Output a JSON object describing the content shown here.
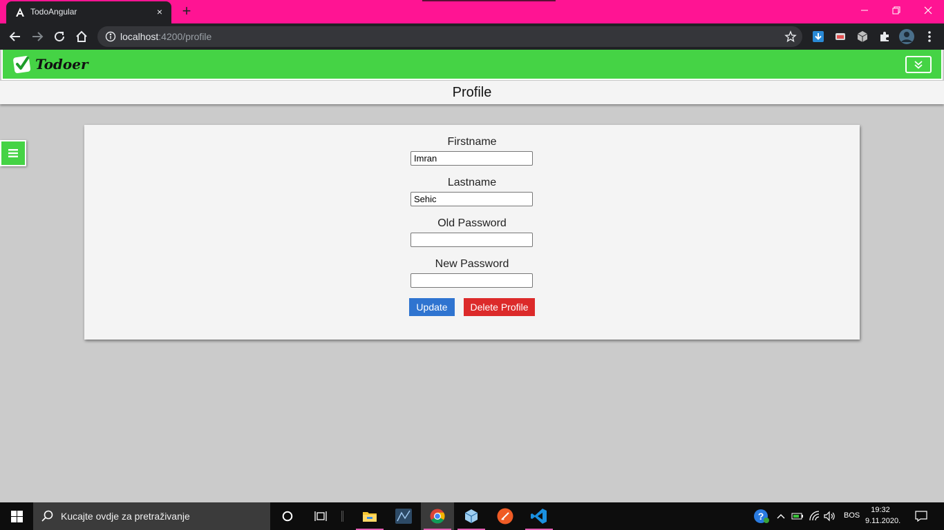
{
  "browser": {
    "tab_title": "TodoAngular",
    "url_host": "localhost",
    "url_path": ":4200/profile",
    "new_tab_symbol": "+",
    "close_symbol": "×",
    "colors": {
      "titlebar": "#ff1493",
      "toolbar": "#202124"
    }
  },
  "app": {
    "brand": "Todoer",
    "page_title": "Profile",
    "colors": {
      "navbar": "#45d345",
      "update": "#2f74d0",
      "delete": "#dc2a2a"
    }
  },
  "form": {
    "firstname": {
      "label": "Firstname",
      "value": "Imran"
    },
    "lastname": {
      "label": "Lastname",
      "value": "Sehic"
    },
    "old_password": {
      "label": "Old Password",
      "value": ""
    },
    "new_password": {
      "label": "New Password",
      "value": ""
    },
    "update_label": "Update",
    "delete_label": "Delete Profile"
  },
  "taskbar": {
    "search_placeholder": "Kucajte ovdje za pretraživanje",
    "language": "BOS",
    "time": "19:32",
    "date": "9.11.2020."
  }
}
